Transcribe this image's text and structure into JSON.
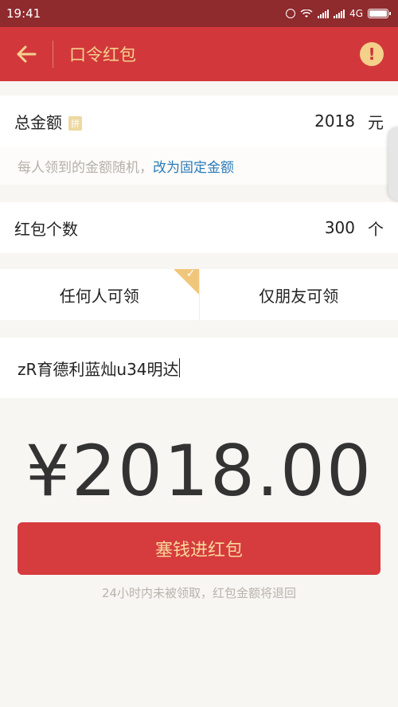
{
  "status_bar": {
    "time": "19:41",
    "network": "4G",
    "icons": [
      "alarm-icon",
      "wifi-icon",
      "signal-icon",
      "signal-icon",
      "battery-icon"
    ]
  },
  "nav": {
    "back_icon": "arrow-left-icon",
    "title": "口令红包",
    "info_icon": "exclamation-circle-icon",
    "info_glyph": "!"
  },
  "total_amount": {
    "label": "总金额",
    "badge": "拼",
    "value": "2018",
    "unit": "元"
  },
  "hint": {
    "text": "每人领到的金额随机，",
    "link": "改为固定金额"
  },
  "count": {
    "label": "红包个数",
    "value": "300",
    "unit": "个"
  },
  "audience": {
    "options": [
      "任何人可领",
      "仅朋友可领"
    ],
    "selected": "任何人可领"
  },
  "password_input": {
    "value": "zR育德利蓝灿u34明达"
  },
  "amount_display": "¥2018.00",
  "submit": {
    "label": "塞钱进红包"
  },
  "footer": {
    "note": "24小时内未被领取，红包金额将退回"
  },
  "colors": {
    "status_bar": "#8f2a2d",
    "nav_bar": "#d2383b",
    "gold": "#f5d08f",
    "button": "#d63b3e",
    "link": "#2b7bb9"
  }
}
